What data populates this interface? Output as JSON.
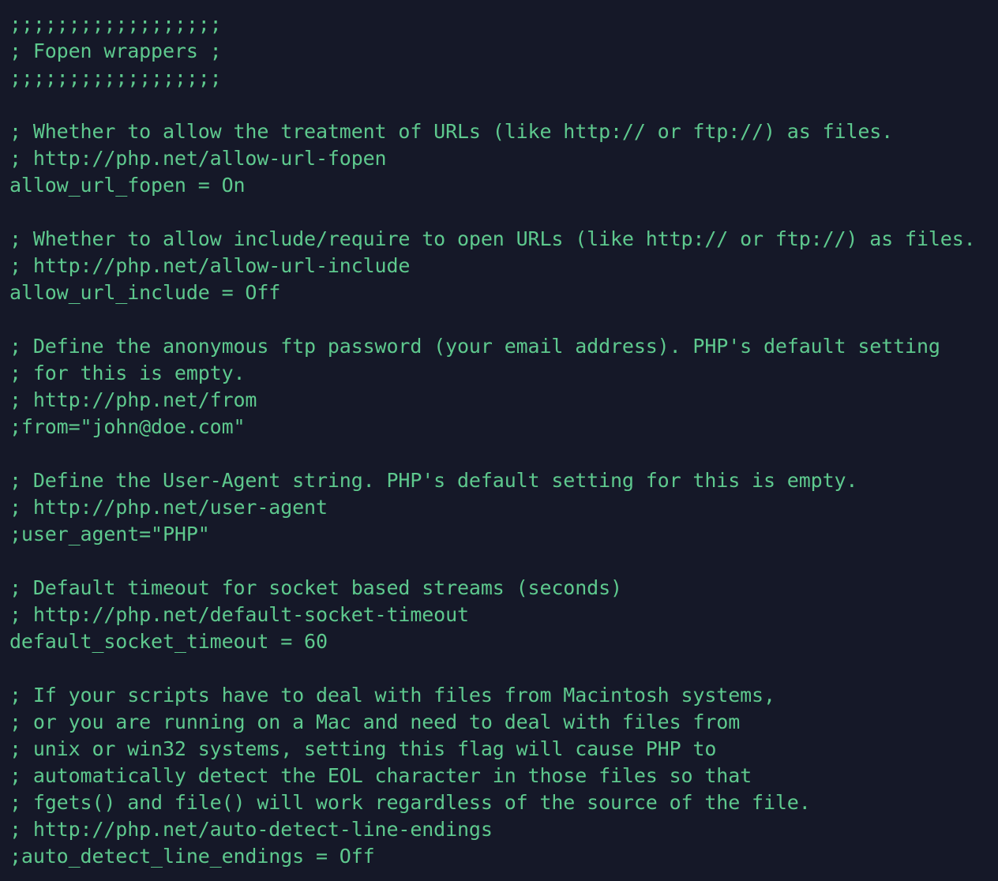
{
  "editor": {
    "language": "ini",
    "file_kind": "php.ini configuration",
    "colors": {
      "background": "#151828",
      "text": "#5ec98e",
      "comment": "#5ec98e",
      "directive": "#5ec98e"
    }
  },
  "section": {
    "border_top": ";;;;;;;;;;;;;;;;;;",
    "title_line": "; Fopen wrappers ;",
    "border_bottom": ";;;;;;;;;;;;;;;;;;",
    "title_text": "Fopen wrappers"
  },
  "lines": [
    {
      "kind": "comment",
      "text": ";;;;;;;;;;;;;;;;;;"
    },
    {
      "kind": "comment",
      "text": "; Fopen wrappers ;"
    },
    {
      "kind": "comment",
      "text": ";;;;;;;;;;;;;;;;;;"
    },
    {
      "kind": "blank",
      "text": ""
    },
    {
      "kind": "comment",
      "text": "; Whether to allow the treatment of URLs (like http:// or ftp://) as files."
    },
    {
      "kind": "comment",
      "text": "; http://php.net/allow-url-fopen"
    },
    {
      "kind": "directive",
      "text": "allow_url_fopen = On"
    },
    {
      "kind": "blank",
      "text": ""
    },
    {
      "kind": "comment",
      "text": "; Whether to allow include/require to open URLs (like http:// or ftp://) as files."
    },
    {
      "kind": "comment",
      "text": "; http://php.net/allow-url-include"
    },
    {
      "kind": "directive",
      "text": "allow_url_include = Off"
    },
    {
      "kind": "blank",
      "text": ""
    },
    {
      "kind": "comment",
      "text": "; Define the anonymous ftp password (your email address). PHP's default setting"
    },
    {
      "kind": "comment",
      "text": "; for this is empty."
    },
    {
      "kind": "comment",
      "text": "; http://php.net/from"
    },
    {
      "kind": "directive",
      "text": ";from=\"john@doe.com\""
    },
    {
      "kind": "blank",
      "text": ""
    },
    {
      "kind": "comment",
      "text": "; Define the User-Agent string. PHP's default setting for this is empty."
    },
    {
      "kind": "comment",
      "text": "; http://php.net/user-agent"
    },
    {
      "kind": "directive",
      "text": ";user_agent=\"PHP\""
    },
    {
      "kind": "blank",
      "text": ""
    },
    {
      "kind": "comment",
      "text": "; Default timeout for socket based streams (seconds)"
    },
    {
      "kind": "comment",
      "text": "; http://php.net/default-socket-timeout"
    },
    {
      "kind": "directive",
      "text": "default_socket_timeout = 60"
    },
    {
      "kind": "blank",
      "text": ""
    },
    {
      "kind": "comment",
      "text": "; If your scripts have to deal with files from Macintosh systems,"
    },
    {
      "kind": "comment",
      "text": "; or you are running on a Mac and need to deal with files from"
    },
    {
      "kind": "comment",
      "text": "; unix or win32 systems, setting this flag will cause PHP to"
    },
    {
      "kind": "comment",
      "text": "; automatically detect the EOL character in those files so that"
    },
    {
      "kind": "comment",
      "text": "; fgets() and file() will work regardless of the source of the file."
    },
    {
      "kind": "comment",
      "text": "; http://php.net/auto-detect-line-endings"
    },
    {
      "kind": "directive",
      "text": ";auto_detect_line_endings = Off"
    }
  ],
  "settings": [
    {
      "name": "allow_url_fopen",
      "value": "On",
      "enabled": true,
      "doc_url": "http://php.net/allow-url-fopen"
    },
    {
      "name": "allow_url_include",
      "value": "Off",
      "enabled": true,
      "doc_url": "http://php.net/allow-url-include"
    },
    {
      "name": "from",
      "value": "\"john@doe.com\"",
      "enabled": false,
      "doc_url": "http://php.net/from"
    },
    {
      "name": "user_agent",
      "value": "\"PHP\"",
      "enabled": false,
      "doc_url": "http://php.net/user-agent"
    },
    {
      "name": "default_socket_timeout",
      "value": "60",
      "enabled": true,
      "doc_url": "http://php.net/default-socket-timeout"
    },
    {
      "name": "auto_detect_line_endings",
      "value": "Off",
      "enabled": false,
      "doc_url": "http://php.net/auto-detect-line-endings"
    }
  ]
}
